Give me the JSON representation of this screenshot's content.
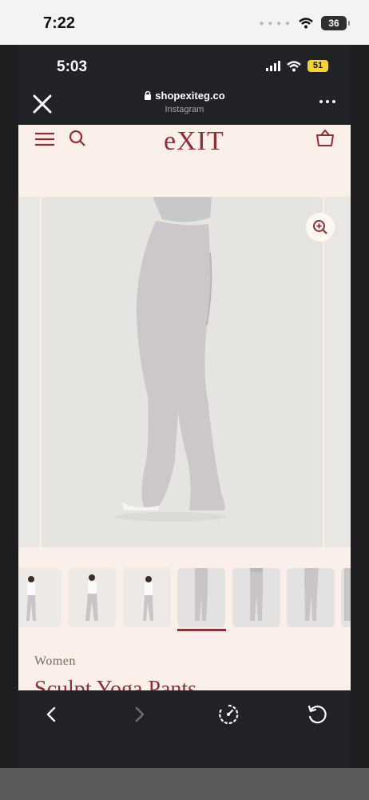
{
  "outer_status": {
    "time": "7:22",
    "battery": "36"
  },
  "inner_status": {
    "time": "5:03",
    "battery": "51"
  },
  "browser": {
    "url": "shopexiteg.co",
    "source": "Instagram"
  },
  "site": {
    "logo": "eXIT",
    "category": "Women",
    "title": "Sculpt Yoga Pants",
    "active_thumbnail": 4
  },
  "icons": [
    "close-icon",
    "lock-icon",
    "more-icon",
    "menu-icon",
    "search-icon",
    "cart-icon",
    "zoom-in-icon",
    "back-icon",
    "forward-icon",
    "speed-icon",
    "reload-icon"
  ],
  "colors": {
    "brand": "#8f2e36",
    "background": "#fbf0e9",
    "browser": "#202225"
  }
}
